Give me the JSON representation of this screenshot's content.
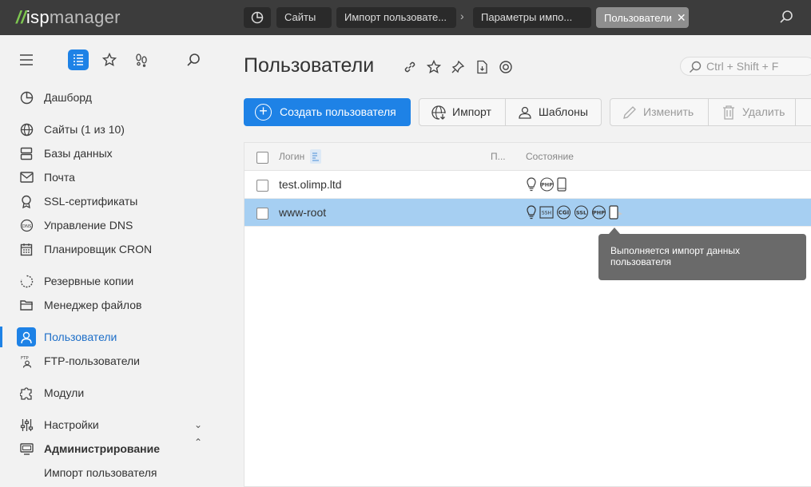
{
  "header": {
    "logo_prefix": "isp",
    "logo_suffix": "manager",
    "breadcrumbs": [
      {
        "label": "Сайты"
      },
      {
        "label": "Импорт пользовате..."
      },
      {
        "label": "Параметры импо..."
      },
      {
        "label": "Пользователи"
      }
    ]
  },
  "sidebar": {
    "items": [
      {
        "label": "Дашборд",
        "icon": "dashboard-icon"
      },
      {
        "label": "Сайты (1 из 10)",
        "icon": "globe-icon"
      },
      {
        "label": "Базы данных",
        "icon": "database-icon"
      },
      {
        "label": "Почта",
        "icon": "mail-icon"
      },
      {
        "label": "SSL-сертификаты",
        "icon": "certificate-icon"
      },
      {
        "label": "Управление DNS",
        "icon": "dns-icon"
      },
      {
        "label": "Планировщик CRON",
        "icon": "calendar-icon"
      },
      {
        "label": "Резервные копии",
        "icon": "backup-icon"
      },
      {
        "label": "Менеджер файлов",
        "icon": "folder-icon"
      },
      {
        "label": "Пользователи",
        "icon": "user-icon"
      },
      {
        "label": "FTP-пользователи",
        "icon": "ftp-icon"
      },
      {
        "label": "Модули",
        "icon": "puzzle-icon"
      },
      {
        "label": "Настройки",
        "icon": "sliders-icon"
      },
      {
        "label": "Администрирование",
        "icon": "admin-icon"
      },
      {
        "label": "Импорт пользователя",
        "icon": ""
      }
    ]
  },
  "main": {
    "title": "Пользователи",
    "search_placeholder": "Ctrl + Shift + F",
    "toolbar": {
      "create": "Создать пользователя",
      "import": "Импорт",
      "templates": "Шаблоны",
      "edit": "Изменить",
      "delete": "Удалить"
    },
    "table": {
      "columns": [
        "Логин",
        "П...",
        "Состояние"
      ],
      "rows": [
        {
          "login": "test.olimp.ltd",
          "status_icons": [
            "bulb-icon",
            "php-icon",
            "device-icon"
          ]
        },
        {
          "login": "www-root",
          "status_icons": [
            "bulb-icon",
            "ssh-icon",
            "cgi-icon",
            "ssl-icon",
            "php-icon",
            "import-progress-icon"
          ]
        }
      ]
    },
    "tooltip": "Выполняется импорт данных пользователя"
  },
  "colors": {
    "accent": "#1e82e6",
    "topbar": "#3c3c3c",
    "selected_row": "#a6cff2",
    "tooltip": "#6a6a6a"
  }
}
